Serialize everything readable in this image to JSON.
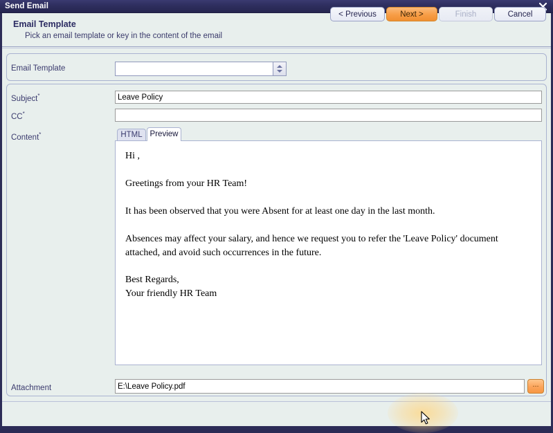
{
  "window": {
    "title": "Send Email",
    "close_icon": "close-icon"
  },
  "header": {
    "title": "Email Template",
    "subtitle": "Pick an email template or key in the content of the email"
  },
  "form": {
    "email_template": {
      "label": "Email Template",
      "value": "",
      "placeholder": "",
      "spinner_icon": "spinner-updown-icon"
    },
    "subject": {
      "label": "Subject",
      "required_mark": "*",
      "value": "Leave Policy",
      "placeholder": ""
    },
    "cc": {
      "label": "CC",
      "required_mark": "*",
      "value": "",
      "placeholder": ""
    },
    "content": {
      "label": "Content",
      "required_mark": "*"
    },
    "attachment": {
      "label": "Attachment",
      "value": "E:\\Leave Policy.pdf",
      "placeholder": "",
      "browse_label": "..."
    }
  },
  "tabs": [
    {
      "id": "html",
      "label": "HTML",
      "active": false
    },
    {
      "id": "preview",
      "label": "Preview",
      "active": true
    }
  ],
  "preview": {
    "paragraphs": [
      "Hi ,",
      "Greetings from your HR Team!",
      "It has been observed that you were Absent for at least one day in the last month.",
      "Absences may affect your salary, and hence we request you to refer the 'Leave Policy' document attached, and avoid such occurrences in the future.",
      "Best Regards,",
      "Your friendly HR Team"
    ]
  },
  "footer": {
    "previous_label": "< Previous",
    "next_label": "Next >",
    "finish_label": "Finish",
    "cancel_label": "Cancel",
    "finish_disabled": true
  },
  "colors": {
    "titlebar": "#2e2e5e",
    "panel_bg": "#e8efed",
    "accent_orange": "#f79d46",
    "label_text": "#3b3b6e",
    "border": "#a9b2d0"
  }
}
